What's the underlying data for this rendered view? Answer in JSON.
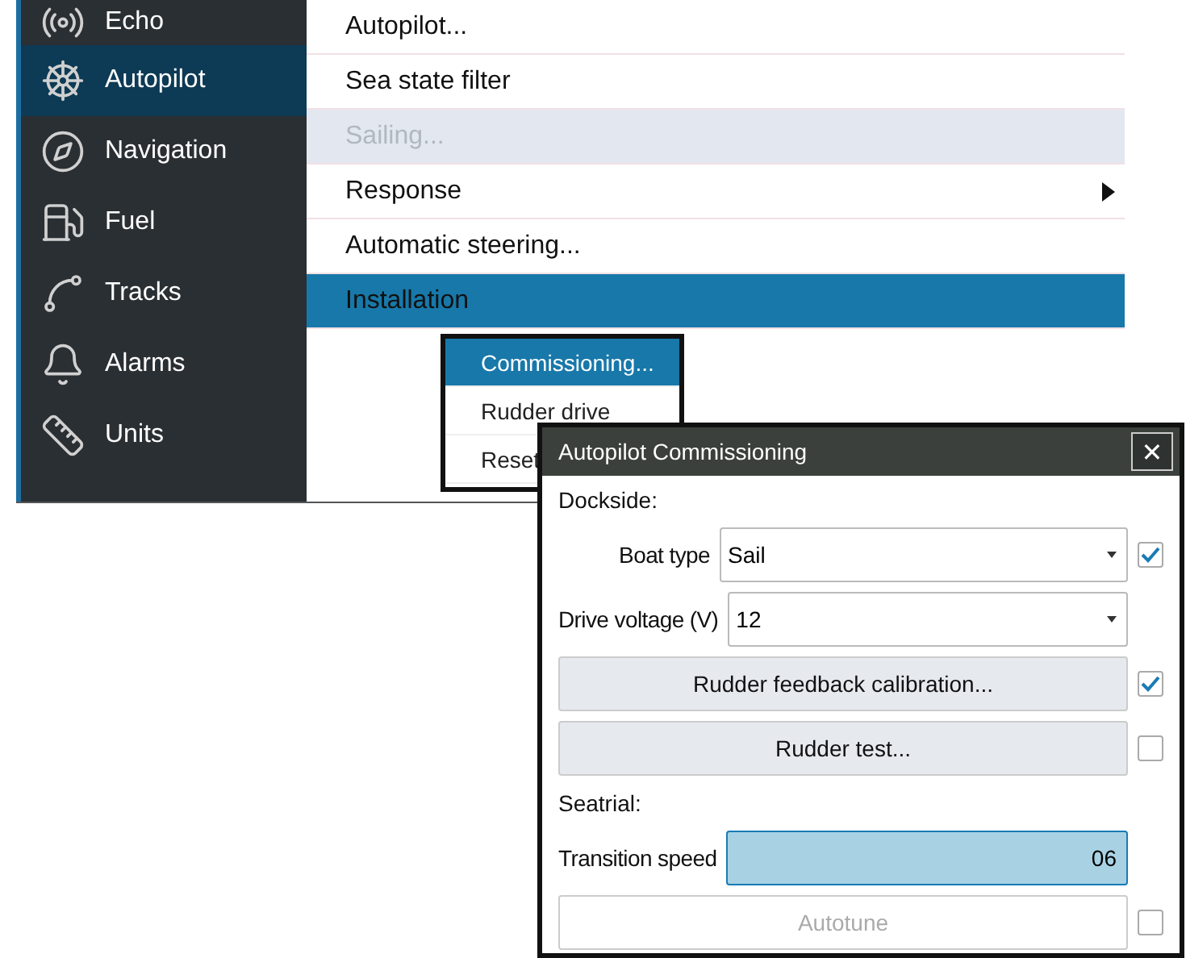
{
  "sidebar": {
    "items": [
      {
        "label": "Echo",
        "selected": false
      },
      {
        "label": "Autopilot",
        "selected": true
      },
      {
        "label": "Navigation",
        "selected": false
      },
      {
        "label": "Fuel",
        "selected": false
      },
      {
        "label": "Tracks",
        "selected": false
      },
      {
        "label": "Alarms",
        "selected": false
      },
      {
        "label": "Units",
        "selected": false
      }
    ]
  },
  "menu": {
    "items": [
      {
        "label": "Autopilot...",
        "selected": false,
        "disabled": false,
        "submenu": false
      },
      {
        "label": "Sea state filter",
        "selected": false,
        "disabled": false,
        "submenu": false
      },
      {
        "label": "Sailing...",
        "selected": false,
        "disabled": true,
        "submenu": false
      },
      {
        "label": "Response",
        "selected": false,
        "disabled": false,
        "submenu": true
      },
      {
        "label": "Automatic steering...",
        "selected": false,
        "disabled": false,
        "submenu": false
      },
      {
        "label": "Installation",
        "selected": true,
        "disabled": false,
        "submenu": false
      }
    ]
  },
  "submenu": {
    "items": [
      {
        "label": "Commissioning...",
        "selected": true
      },
      {
        "label": "Rudder drive",
        "selected": false
      },
      {
        "label": "Reset",
        "selected": false
      }
    ]
  },
  "dialog": {
    "title": "Autopilot Commissioning",
    "close": "✕",
    "rows": [
      {
        "kind": "heading",
        "label": "Dockside:"
      },
      {
        "kind": "dropdown",
        "label": "Boat type",
        "value": "Sail",
        "checked": true
      },
      {
        "kind": "dropdown",
        "label": "Drive voltage (V)",
        "value": "12"
      },
      {
        "kind": "button",
        "label": "Rudder feedback calibration...",
        "disabled": false,
        "checked": true
      },
      {
        "kind": "button",
        "label": "Rudder test...",
        "disabled": false,
        "checked": false
      },
      {
        "kind": "heading",
        "label": "Seatrial:"
      },
      {
        "kind": "number",
        "label": "Transition speed",
        "value": "06"
      },
      {
        "kind": "button",
        "label": "Autotune",
        "disabled": true,
        "checked": false
      }
    ]
  }
}
